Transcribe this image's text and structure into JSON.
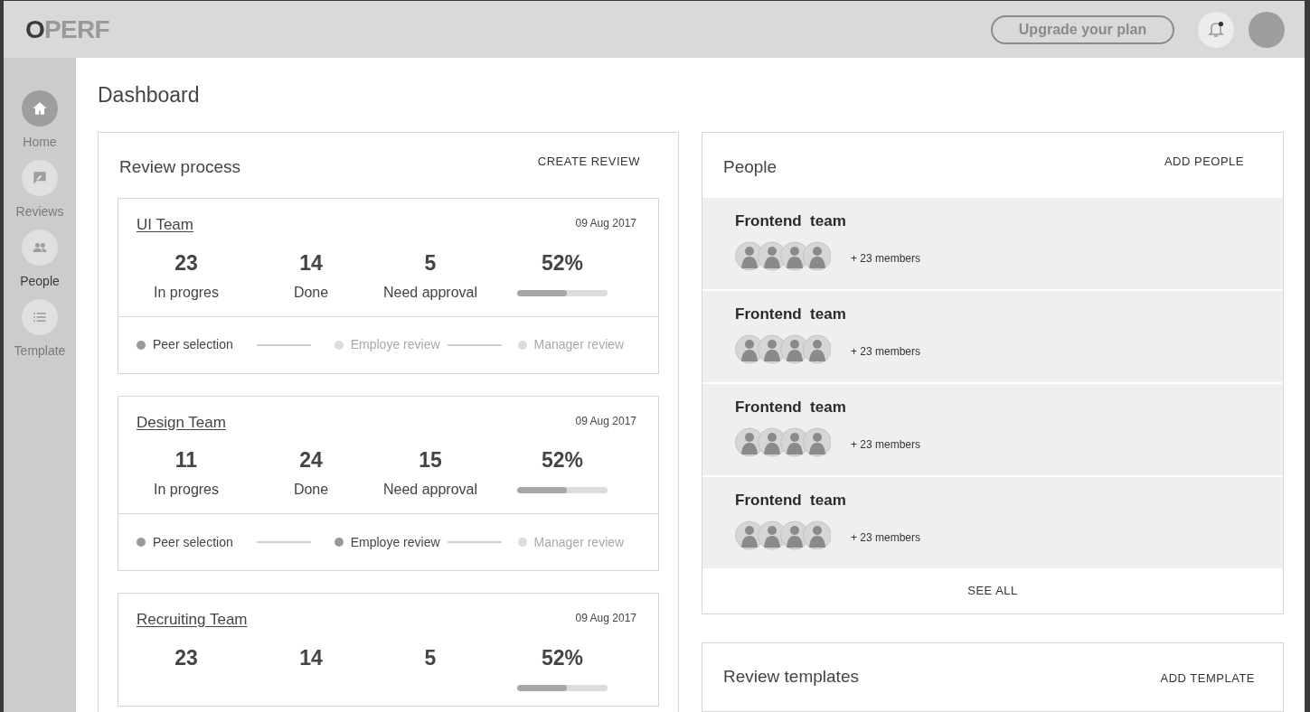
{
  "header": {
    "logo": "OPERF",
    "upgrade_button": "Upgrade your plan",
    "notification_dot": true
  },
  "sidebar": {
    "items": [
      {
        "label": "Home",
        "selected": false,
        "highlighted": true,
        "kind": "home"
      },
      {
        "label": "Reviews",
        "selected": false,
        "highlighted": false,
        "kind": "review"
      },
      {
        "label": "People",
        "selected": true,
        "highlighted": false,
        "kind": "people"
      },
      {
        "label": "Template",
        "selected": false,
        "highlighted": false,
        "kind": "list"
      }
    ]
  },
  "page_title": "Dashboard",
  "review_process": {
    "title": "Review process",
    "action": "CREATE REVIEW",
    "cards": [
      {
        "name": "UI Team",
        "date": "09 Aug 2017",
        "stats": [
          {
            "value": "23",
            "label": "In progres"
          },
          {
            "value": "14",
            "label": "Done"
          },
          {
            "value": "5",
            "label": "Need approval"
          }
        ],
        "percent": "52%",
        "level": 0.55,
        "steps": [
          {
            "label": "Peer selection",
            "done": true
          },
          {
            "label": "Employe review",
            "done": false
          },
          {
            "label": "Manager review",
            "done": false
          }
        ]
      },
      {
        "name": "Design Team",
        "date": "09 Aug 2017",
        "stats": [
          {
            "value": "11",
            "label": "In progres"
          },
          {
            "value": "24",
            "label": "Done"
          },
          {
            "value": "15",
            "label": "Need approval"
          }
        ],
        "percent": "52%",
        "level": 0.55,
        "steps": [
          {
            "label": "Peer selection",
            "done": true
          },
          {
            "label": "Employe review",
            "done": true
          },
          {
            "label": "Manager review",
            "done": false
          }
        ]
      },
      {
        "name": "Recruiting Team",
        "date": "09 Aug 2017",
        "stats": [
          {
            "value": "23"
          },
          {
            "value": "14"
          },
          {
            "value": "5"
          }
        ],
        "percent": "52%",
        "level": 0.55
      }
    ]
  },
  "people": {
    "title": "People",
    "action": "ADD PEOPLE",
    "teams": [
      {
        "name": "Frontend  team",
        "members": "+ 23 members"
      },
      {
        "name": "Frontend  team",
        "members": "+ 23 members"
      },
      {
        "name": "Frontend  team",
        "members": "+ 23 members"
      },
      {
        "name": "Frontend  team",
        "members": "+ 23 members"
      }
    ],
    "see_all": "SEE ALL"
  },
  "review_templates": {
    "title": "Review templates",
    "action": "ADD TEMPLATE"
  }
}
